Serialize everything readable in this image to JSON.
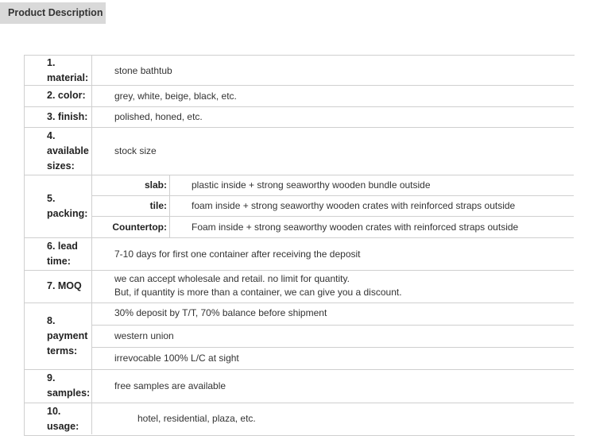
{
  "tab_label": "Product Description",
  "rows": {
    "material": {
      "label": "1. material:",
      "value": "stone bathtub"
    },
    "color": {
      "label": "2. color:",
      "value": "grey, white, beige, black, etc."
    },
    "finish": {
      "label": "3. finish:",
      "value": "polished, honed, etc."
    },
    "sizes": {
      "label": "4. available sizes:",
      "value": "stock size"
    },
    "packing": {
      "label": "5. packing:",
      "slab": {
        "label": "slab:",
        "value": "plastic inside + strong seaworthy wooden bundle outside"
      },
      "tile": {
        "label": "tile:",
        "value": "foam inside + strong seaworthy wooden crates with reinforced straps outside"
      },
      "countertop": {
        "label": "Countertop:",
        "value": "Foam inside + strong seaworthy wooden crates with reinforced straps outside"
      }
    },
    "lead_time": {
      "label": "6. lead time:",
      "value": "7-10 days for first one container after receiving the deposit"
    },
    "moq": {
      "label": "7. MOQ",
      "line1": "we can accept wholesale and retail. no limit for quantity.",
      "line2": "But, if quantity is more than a container, we can give you a discount."
    },
    "payment": {
      "label": "8. payment terms:",
      "options": [
        "30% deposit by T/T, 70% balance before shipment",
        "western union",
        "irrevocable 100% L/C at sight"
      ]
    },
    "samples": {
      "label": "9. samples:",
      "value": "free samples are available"
    },
    "usage": {
      "label": "10. usage:",
      "value": "hotel, residential, plaza, etc."
    }
  }
}
